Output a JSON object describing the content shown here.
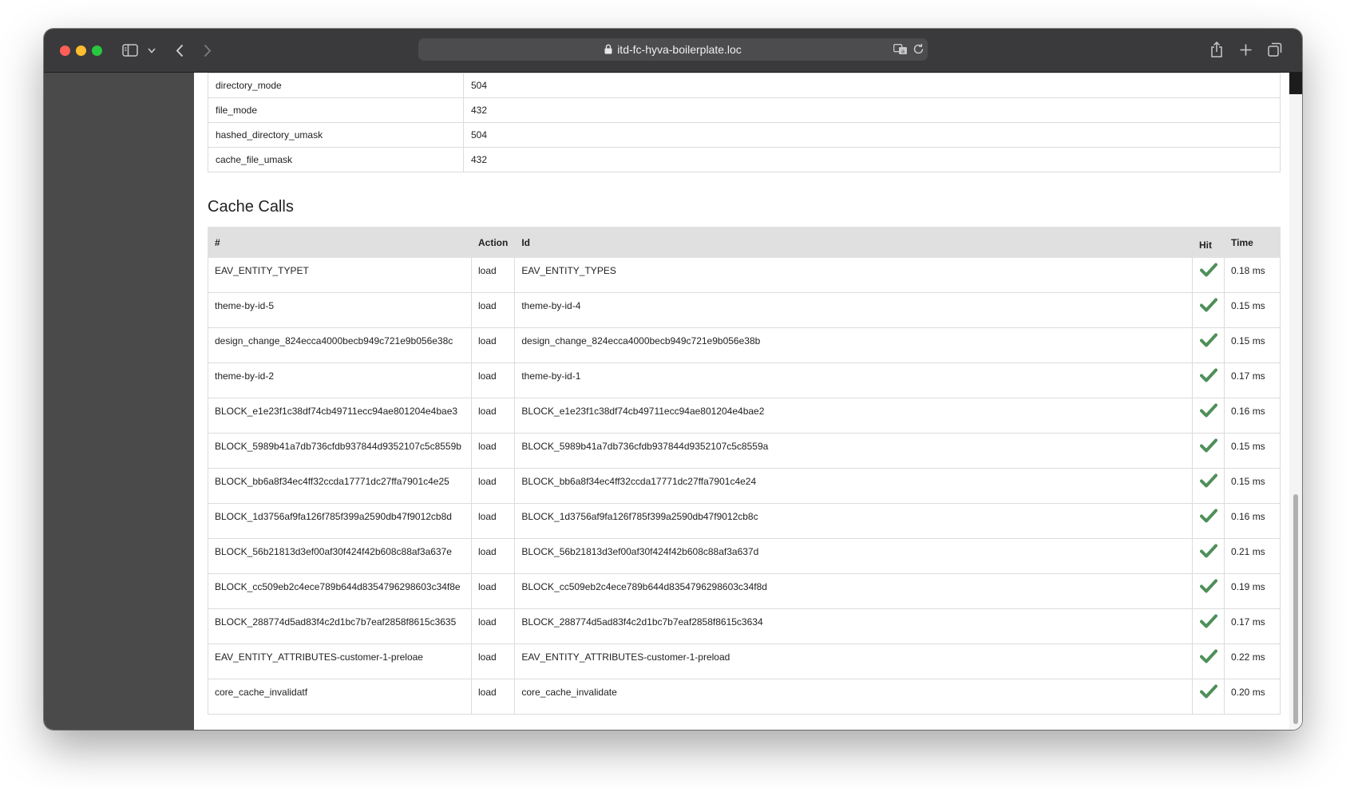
{
  "browser": {
    "url": "itd-fc-hyva-boilerplate.loc"
  },
  "config_rows": [
    {
      "key": "directory_mode",
      "value": "504"
    },
    {
      "key": "file_mode",
      "value": "432"
    },
    {
      "key": "hashed_directory_umask",
      "value": "504"
    },
    {
      "key": "cache_file_umask",
      "value": "432"
    }
  ],
  "cache_calls": {
    "title": "Cache Calls",
    "columns": {
      "num": "#",
      "action": "Action",
      "id": "Id",
      "hit": "Hit",
      "time": "Time"
    },
    "hit_icon": "check-icon",
    "hit_color": "#4f8f5a",
    "rows": [
      {
        "num": "EAV_ENTITY_TYPET",
        "action": "load",
        "id": "EAV_ENTITY_TYPES",
        "time": "0.18 ms"
      },
      {
        "num": "theme-by-id-5",
        "action": "load",
        "id": "theme-by-id-4",
        "time": "0.15 ms"
      },
      {
        "num": "design_change_824ecca4000becb949c721e9b056e38c",
        "action": "load",
        "id": "design_change_824ecca4000becb949c721e9b056e38b",
        "time": "0.15 ms"
      },
      {
        "num": "theme-by-id-2",
        "action": "load",
        "id": "theme-by-id-1",
        "time": "0.17 ms"
      },
      {
        "num": "BLOCK_e1e23f1c38df74cb49711ecc94ae801204e4bae3",
        "action": "load",
        "id": "BLOCK_e1e23f1c38df74cb49711ecc94ae801204e4bae2",
        "time": "0.16 ms"
      },
      {
        "num": "BLOCK_5989b41a7db736cfdb937844d9352107c5c8559b",
        "action": "load",
        "id": "BLOCK_5989b41a7db736cfdb937844d9352107c5c8559a",
        "time": "0.15 ms"
      },
      {
        "num": "BLOCK_bb6a8f34ec4ff32ccda17771dc27ffa7901c4e25",
        "action": "load",
        "id": "BLOCK_bb6a8f34ec4ff32ccda17771dc27ffa7901c4e24",
        "time": "0.15 ms"
      },
      {
        "num": "BLOCK_1d3756af9fa126f785f399a2590db47f9012cb8d",
        "action": "load",
        "id": "BLOCK_1d3756af9fa126f785f399a2590db47f9012cb8c",
        "time": "0.16 ms"
      },
      {
        "num": "BLOCK_56b21813d3ef00af30f424f42b608c88af3a637e",
        "action": "load",
        "id": "BLOCK_56b21813d3ef00af30f424f42b608c88af3a637d",
        "time": "0.21 ms"
      },
      {
        "num": "BLOCK_cc509eb2c4ece789b644d8354796298603c34f8e",
        "action": "load",
        "id": "BLOCK_cc509eb2c4ece789b644d8354796298603c34f8d",
        "time": "0.19 ms"
      },
      {
        "num": "BLOCK_288774d5ad83f4c2d1bc7b7eaf2858f8615c3635",
        "action": "load",
        "id": "BLOCK_288774d5ad83f4c2d1bc7b7eaf2858f8615c3634",
        "time": "0.17 ms"
      },
      {
        "num": "EAV_ENTITY_ATTRIBUTES-customer-1-preloae",
        "action": "load",
        "id": "EAV_ENTITY_ATTRIBUTES-customer-1-preload",
        "time": "0.22 ms"
      },
      {
        "num": "core_cache_invalidatf",
        "action": "load",
        "id": "core_cache_invalidate",
        "time": "0.20 ms"
      }
    ]
  }
}
